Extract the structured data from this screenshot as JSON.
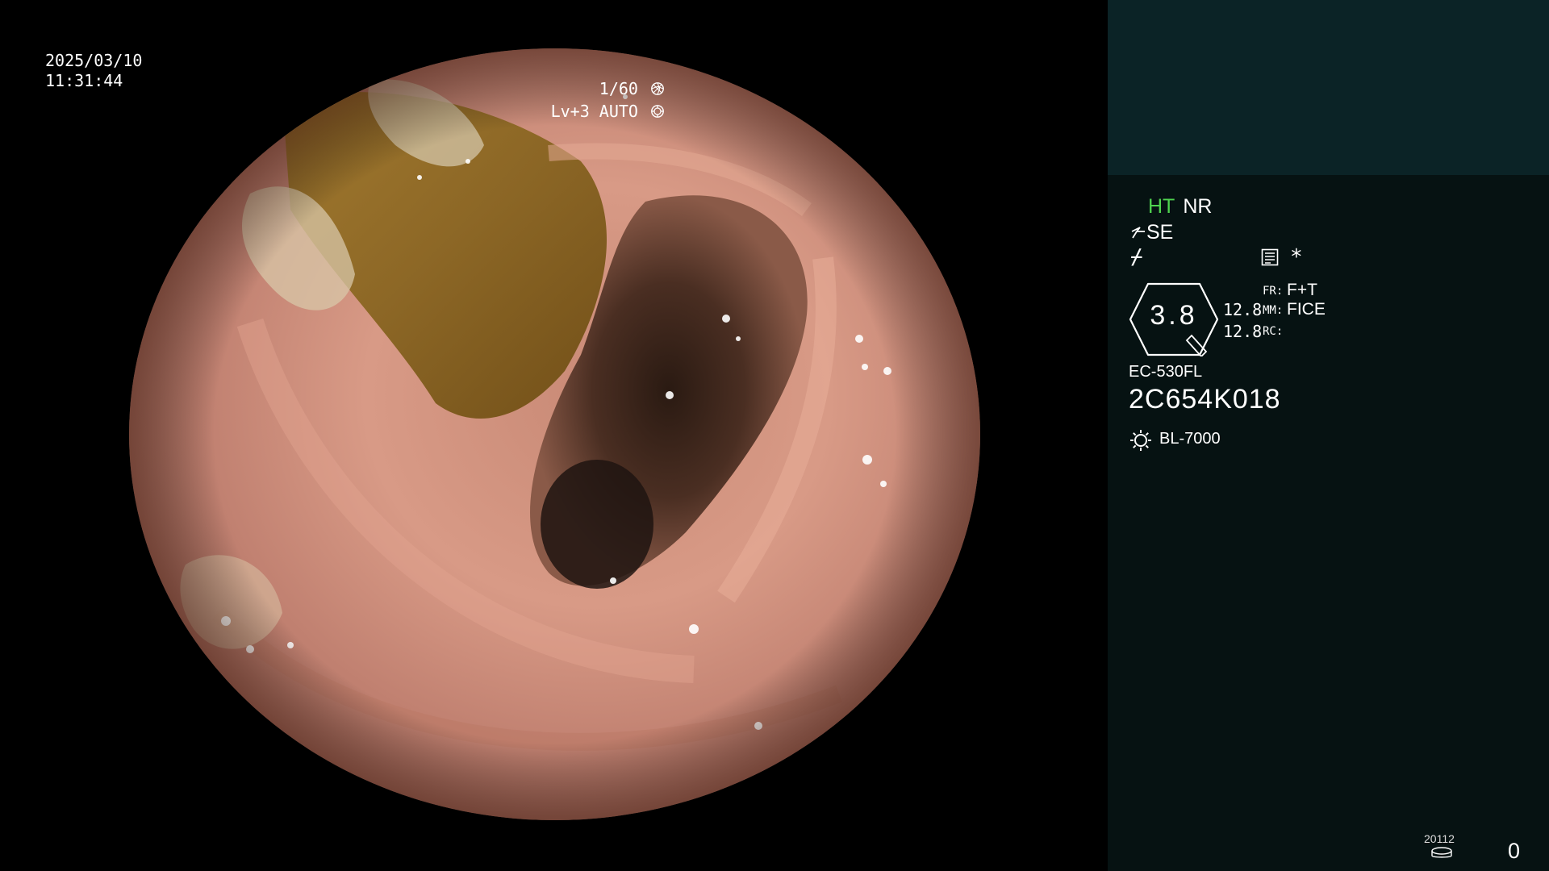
{
  "overlay": {
    "date": "2025/03/10",
    "time": "11:31:44",
    "shutter": "1/60",
    "level": "Lv+3 AUTO",
    "shutter_icon": "aperture-icon",
    "level_icon": "iris-icon"
  },
  "panel": {
    "ht": "HT",
    "nr": "NR",
    "se": "SE",
    "se_icon": "filter-arrow-icon",
    "slash_symbol": "⌿",
    "menu_icon": "menu-list-icon",
    "star": "*",
    "gauge_value": "3.8",
    "num1": "12.8",
    "num2": "12.8",
    "fr_label": "FR:",
    "fr_value": "F+T",
    "mm_label": "MM:",
    "mm_value": "FICE",
    "rc_label": "RC:",
    "scope_model": "EC-530FL",
    "scope_serial": "2C654K018",
    "light_icon": "lamp-icon",
    "light_source": "BL-7000",
    "counter_label": "20112",
    "counter_icon": "disk-icon",
    "counter_value": "0"
  },
  "colors": {
    "panel_bg": "#061212",
    "thumb_bg": "#0b2326",
    "ht_green": "#4fd34f"
  }
}
